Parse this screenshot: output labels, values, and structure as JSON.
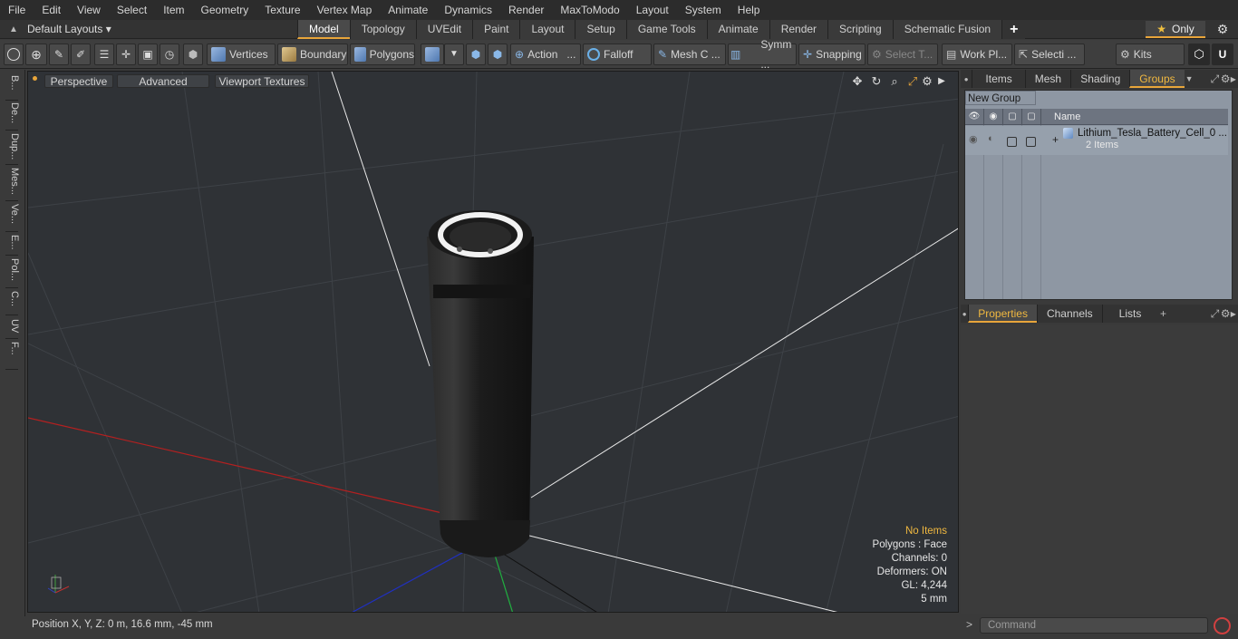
{
  "menu": [
    "File",
    "Edit",
    "View",
    "Select",
    "Item",
    "Geometry",
    "Texture",
    "Vertex Map",
    "Animate",
    "Dynamics",
    "Render",
    "MaxToModo",
    "Layout",
    "System",
    "Help"
  ],
  "layout_selector": "Default Layouts",
  "mode_tabs": [
    "Model",
    "Topology",
    "UVEdit",
    "Paint",
    "Layout",
    "Setup",
    "Game Tools",
    "Animate",
    "Render",
    "Scripting",
    "Schematic Fusion"
  ],
  "active_mode_tab": "Model",
  "only_button": "Only",
  "toolbar": {
    "vertices": "Vertices",
    "boundary": "Boundary",
    "polygons": "Polygons",
    "action": "Action",
    "action_more": "...",
    "falloff": "Falloff",
    "mesh_c": "Mesh C ...",
    "symm": "Symm ...",
    "snapping": "Snapping",
    "select_t": "Select T...",
    "work_pl": "Work Pl...",
    "selecti": "Selecti ...",
    "kits": "Kits"
  },
  "left_tabs": [
    "B...",
    "De...",
    "Dup...",
    "Mes...",
    "Ve...",
    "E...",
    "Pol...",
    "C...",
    "UV",
    "F..."
  ],
  "viewport": {
    "perspective": "Perspective",
    "advanced": "Advanced",
    "viewport_textures": "Viewport Textures",
    "info": {
      "no_items": "No Items",
      "polygons": "Polygons : Face",
      "channels": "Channels: 0",
      "deformers": "Deformers: ON",
      "gl": "GL: 4,244",
      "scale": "5 mm"
    }
  },
  "status_bar": "Position X, Y, Z:   0 m, 16.6 mm, -45 mm",
  "right_panel": {
    "top_tabs": [
      "Items",
      "Mesh ...",
      "Shading",
      "Groups"
    ],
    "active_top_tab": "Groups",
    "new_group": "New Group",
    "name_header": "Name",
    "group_item": {
      "name": "Lithium_Tesla_Battery_Cell_0 ...",
      "count": "2 Items"
    },
    "bottom_tabs": [
      "Properties",
      "Channels",
      "Lists"
    ],
    "active_bottom_tab": "Properties",
    "command_placeholder": "Command"
  },
  "colors": {
    "accent": "#e8a53a",
    "viewport_bg": "#2f3236",
    "groups_bg": "#8e97a3",
    "info_highlight": "#f0b840"
  }
}
